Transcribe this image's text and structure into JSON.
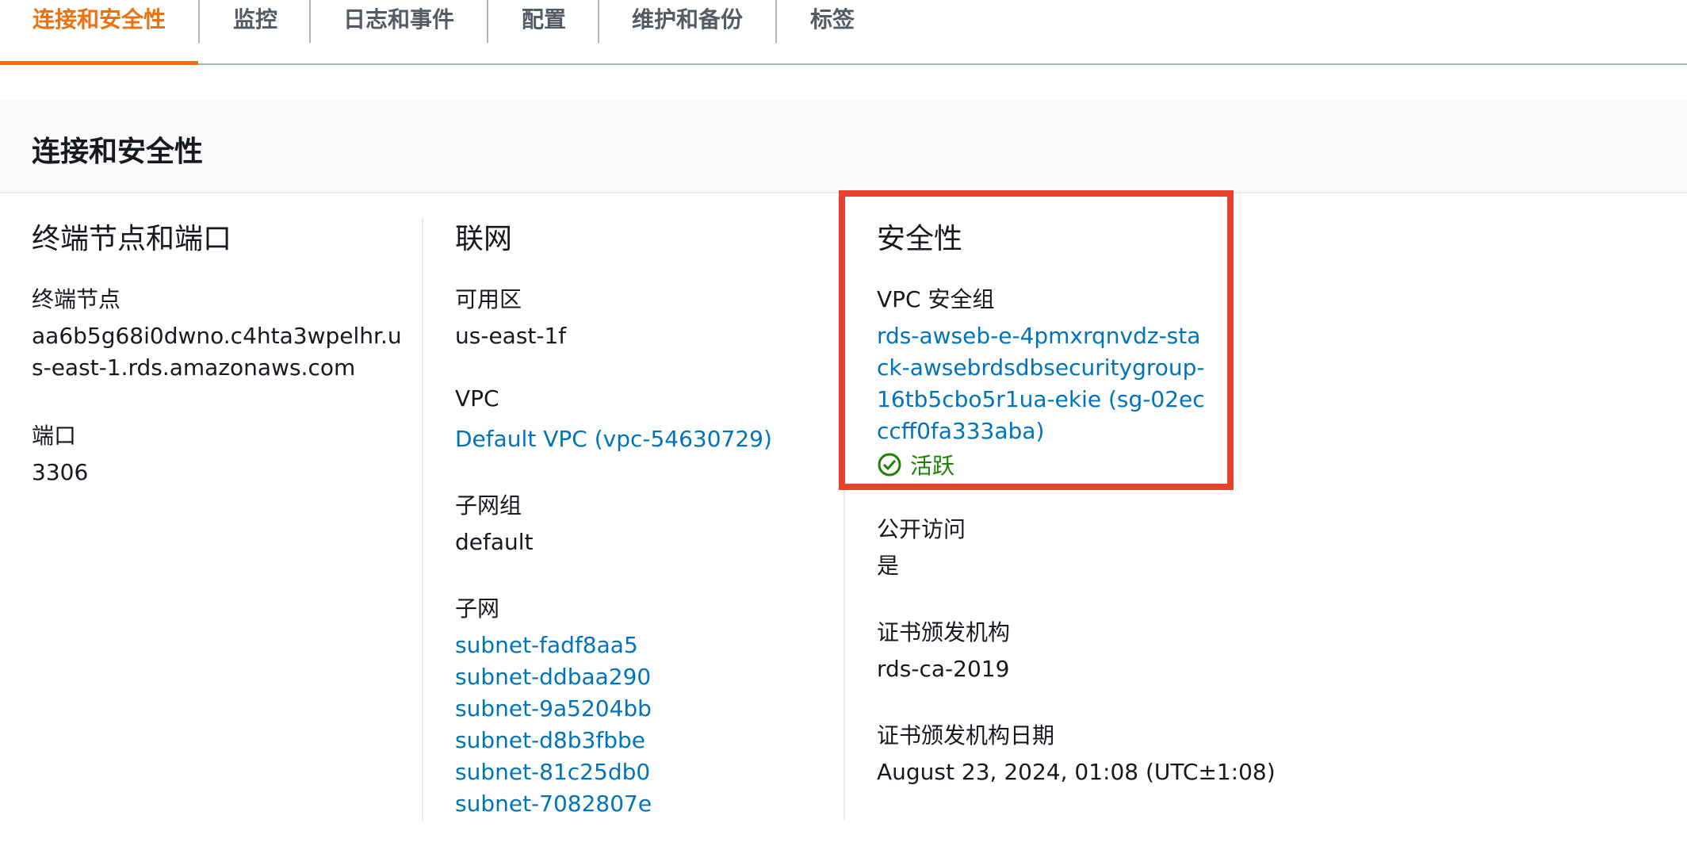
{
  "tabs": [
    {
      "label": "连接和安全性",
      "active": true
    },
    {
      "label": "监控",
      "active": false
    },
    {
      "label": "日志和事件",
      "active": false
    },
    {
      "label": "配置",
      "active": false
    },
    {
      "label": "维护和备份",
      "active": false
    },
    {
      "label": "标签",
      "active": false
    }
  ],
  "panel": {
    "title": "连接和安全性"
  },
  "endpoint_section": {
    "title": "终端节点和端口",
    "endpoint_label": "终端节点",
    "endpoint_value": "aa6b5g68i0dwno.c4hta3wpelhr.us-east-1.rds.amazonaws.com",
    "port_label": "端口",
    "port_value": "3306"
  },
  "network_section": {
    "title": "联网",
    "az_label": "可用区",
    "az_value": "us-east-1f",
    "vpc_label": "VPC",
    "vpc_value": "Default VPC (vpc-54630729)",
    "subnet_group_label": "子网组",
    "subnet_group_value": "default",
    "subnets_label": "子网",
    "subnets": [
      "subnet-fadf8aa5",
      "subnet-ddbaa290",
      "subnet-9a5204bb",
      "subnet-d8b3fbbe",
      "subnet-81c25db0",
      "subnet-7082807e"
    ]
  },
  "security_section": {
    "title": "安全性",
    "vpc_sg_label": "VPC 安全组",
    "vpc_sg_value": "rds-awseb-e-4pmxrqnvdz-stack-awsebrdsdbsecuritygroup-16tb5cbo5r1ua-ekie (sg-02ecccff0fa333aba)",
    "vpc_sg_status": "活跃",
    "public_access_label": "公开访问",
    "public_access_value": "是",
    "ca_label": "证书颁发机构",
    "ca_value": "rds-ca-2019",
    "ca_date_label": "证书颁发机构日期",
    "ca_date_value": "August 23, 2024, 01:08 (UTC±1:08)"
  },
  "colors": {
    "active_tab": "#ec7211",
    "link": "#0073bb",
    "success": "#1d8102",
    "highlight": "#e8412c"
  }
}
